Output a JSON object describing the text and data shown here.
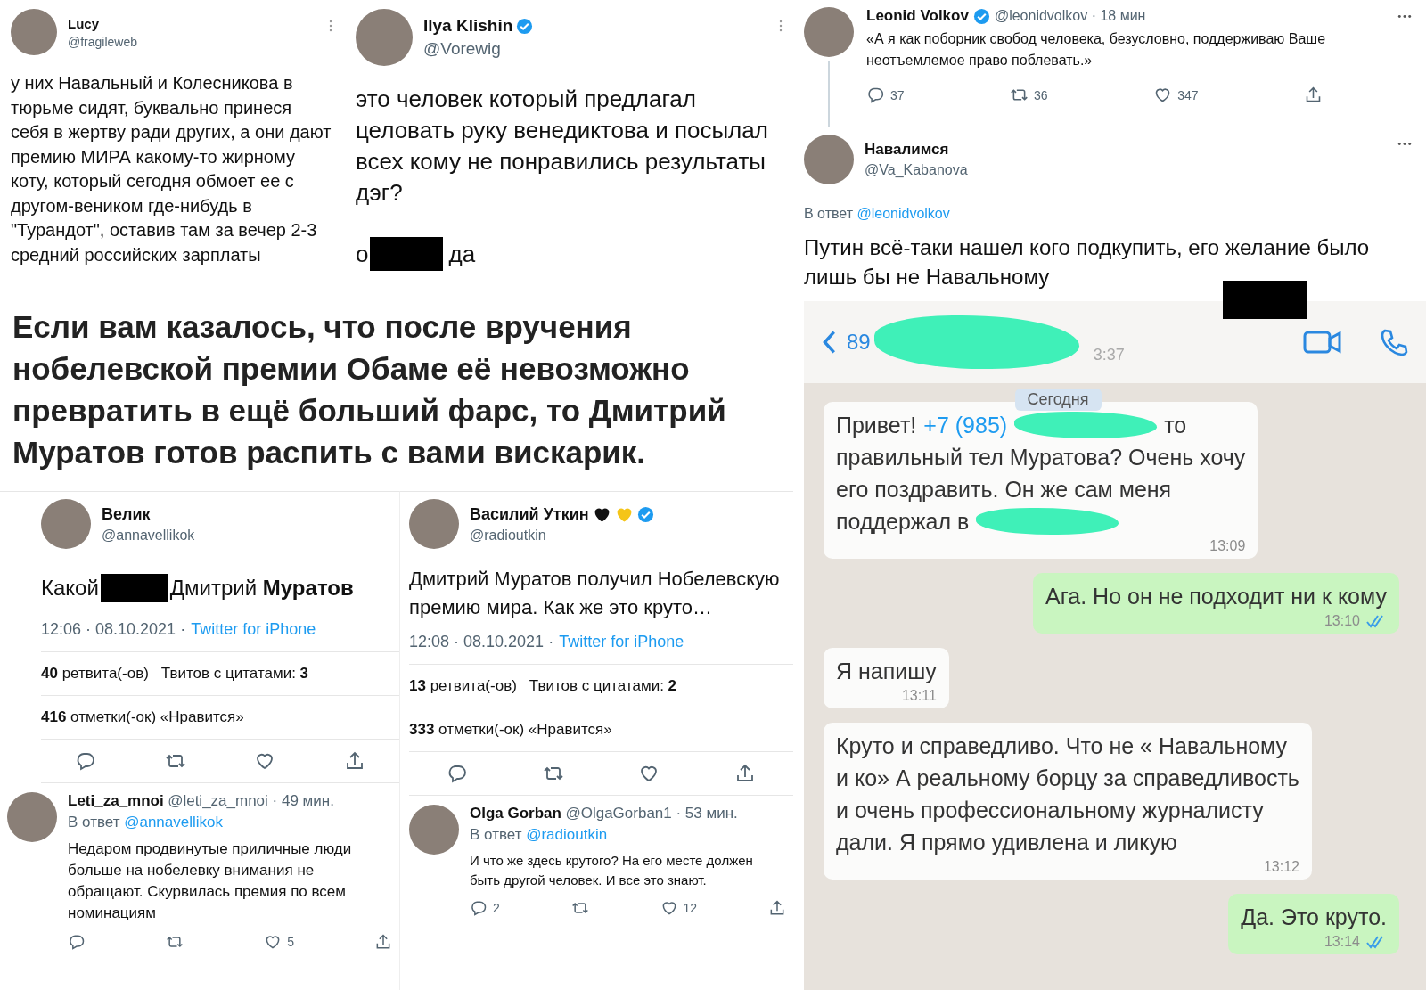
{
  "top_tweets": [
    {
      "name": "Lucy",
      "handle": "@fragileweb",
      "verified": false,
      "paragraphs": [
        [
          {
            "kind": "text",
            "text": "у них Навальный и Колесникова в тюрьме сидят, буквально принеся себя в жертву ради других, а они дают премию МИРА какому-то жирному коту, который сегодня обмоет ее с другом-веником где-нибудь в \"Турандот\", оставив там за вечер 2-3 средний российских зарплаты"
          }
        ]
      ]
    },
    {
      "name": "Ilya Klishin",
      "handle": "@Vorewig",
      "verified": true,
      "paragraphs": [
        [
          {
            "kind": "text",
            "text": "это человек который предлагал целовать руку венедиктова и посылал всех кому не понравились результаты дэг?"
          }
        ],
        [
          {
            "kind": "text",
            "text": "о"
          },
          {
            "kind": "redaction"
          },
          {
            "kind": "text",
            "text": "да"
          }
        ]
      ]
    }
  ],
  "headline": "Если вам казалось, что после вручения нобелевской премии Обаме её невозможно превратить в ещё больший фарс, то Дмитрий Муратов готов распить с вами вискарик.",
  "detail_tweets": [
    {
      "name": "Велик",
      "handle": "@annavellikok",
      "verified": false,
      "body": [
        {
          "kind": "text",
          "text": "Какой"
        },
        {
          "kind": "redaction"
        },
        {
          "kind": "text",
          "text": "Дмитрий **Муратов**"
        }
      ],
      "timestamp": "12:06 · 08.10.2021 ·",
      "source": "Twitter for iPhone",
      "retweets": "**40** ретвита(-ов)",
      "quotes": "Твитов с цитатами: **3**",
      "likes": "**416** отметки(-ок) «Нравится»",
      "reply": {
        "name": "Leti_za_mnoi",
        "handle": "@leti_za_mnoi · 49 мин.",
        "reply_label": "В ответ",
        "reply_to": "@annavellikok",
        "text": "Недаром продвинутые приличные люди больше на нобелевку внимания не обращают. Скурвилась премия по всем номинациям",
        "actions": [
          {
            "kind": "reply"
          },
          {
            "kind": "retweet"
          },
          {
            "kind": "like",
            "count": "5"
          },
          {
            "kind": "share"
          }
        ]
      }
    },
    {
      "name": "Василий Уткин",
      "handle": "@radioutkin",
      "verified": true,
      "badges": [
        {
          "kind": "heart",
          "color": "#111111"
        },
        {
          "kind": "heart",
          "color": "#f5c518"
        }
      ],
      "body": [
        {
          "kind": "text",
          "text": "Дмитрий Муратов получил Нобелевскую премию мира. Как же это круто…"
        }
      ],
      "timestamp": "12:08 · 08.10.2021 ·",
      "source": "Twitter for iPhone",
      "retweets": "**13** ретвита(-ов)",
      "quotes": "Твитов с цитатами: **2**",
      "likes": "**333** отметки(-ок) «Нравится»",
      "reply": {
        "name": "Olga Gorban",
        "handle": "@OlgaGorban1 · 53 мин.",
        "reply_label": "В ответ",
        "reply_to": "@radioutkin",
        "text": "И что же здесь крутого? На его месте должен быть другой человек. И все это знают.",
        "actions": [
          {
            "kind": "reply",
            "count": "2"
          },
          {
            "kind": "retweet"
          },
          {
            "kind": "like",
            "count": "12"
          },
          {
            "kind": "share"
          }
        ]
      }
    }
  ],
  "thread": {
    "tweet": {
      "name": "Leonid Volkov",
      "verified": true,
      "handle": "@leonidvolkov · 18 мин",
      "text": "«А я как поборник свобод человека, безусловно, поддерживаю Ваше неотъемлемое право поблевать.»",
      "actions": [
        {
          "kind": "reply",
          "count": "37"
        },
        {
          "kind": "retweet",
          "count": "36"
        },
        {
          "kind": "like",
          "count": "347"
        },
        {
          "kind": "share"
        }
      ]
    },
    "reply": {
      "name": "Навалимся",
      "handle": "@Va_Kabanova",
      "reply_label": "В ответ",
      "reply_to": "@leonidvolkov",
      "text": "Путин всё-таки нашел кого подкупить, его желание было лишь бы не Навальному"
    }
  },
  "chat": {
    "covers": [
      {
        "kind": "redaction"
      }
    ],
    "title": [
      {
        "kind": "text",
        "text": "89"
      },
      {
        "kind": "scribble"
      }
    ],
    "time": "3:37",
    "date": "Сегодня",
    "messages": [
      {
        "kind": "incoming",
        "read": false,
        "time": "13:09",
        "lines": [
          [
            {
              "kind": "text",
              "text": "Привет!"
            },
            {
              "kind": "link",
              "text": "+7 (985)"
            },
            {
              "kind": "scribble"
            },
            {
              "kind": "text",
              "text": "то"
            }
          ],
          [
            {
              "kind": "text",
              "text": "правильный тел Муратова? Очень хочу"
            }
          ],
          [
            {
              "kind": "text",
              "text": "его поздравить. Он же сам меня"
            }
          ],
          [
            {
              "kind": "text",
              "text": "поддержал в"
            },
            {
              "kind": "scribble"
            }
          ]
        ]
      },
      {
        "kind": "outgoing",
        "read": true,
        "time": "13:10",
        "lines": [
          [
            {
              "kind": "text",
              "text": "Ага. Но он не подходит ни к кому"
            }
          ]
        ]
      },
      {
        "kind": "incoming",
        "read": false,
        "time": "13:11",
        "lines": [
          [
            {
              "kind": "text",
              "text": "Я напишу"
            }
          ]
        ]
      },
      {
        "kind": "incoming",
        "read": false,
        "time": "13:12",
        "lines": [
          [
            {
              "kind": "text",
              "text": "Круто и справедливо. Что не « Навальному и ко» А реальному борцу за справедливость и очень профессиональному журналисту дали. Я прямо удивлена и ликую"
            }
          ]
        ]
      },
      {
        "kind": "outgoing",
        "read": true,
        "time": "13:14",
        "lines": [
          [
            {
              "kind": "text",
              "text": "Да. Это круто."
            }
          ]
        ]
      }
    ]
  }
}
